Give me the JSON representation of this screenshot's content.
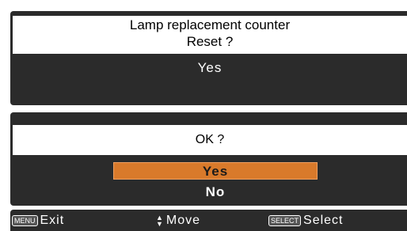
{
  "dialog": {
    "title": "Lamp replacement counter",
    "question": "Reset ?",
    "first_option": "Yes"
  },
  "confirm": {
    "question": "OK ?",
    "options": [
      {
        "label": "Yes",
        "selected": true
      },
      {
        "label": "No",
        "selected": false
      }
    ],
    "highlight_color": "#d97a2b"
  },
  "footer": {
    "exit_key": "MENU",
    "exit_label": "Exit",
    "move_label": "Move",
    "select_key": "SELECT",
    "select_label": "Select"
  }
}
